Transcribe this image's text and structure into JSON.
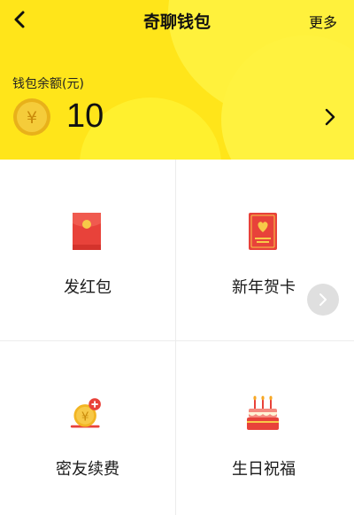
{
  "header": {
    "title": "奇聊钱包",
    "more_label": "更多"
  },
  "balance": {
    "label": "钱包余额(元)",
    "amount": "10",
    "coin_symbol": "¥"
  },
  "actions": [
    {
      "label": "发红包",
      "icon": "red-envelope-icon"
    },
    {
      "label": "新年贺卡",
      "icon": "new-year-card-icon"
    },
    {
      "label": "密友续费",
      "icon": "yen-coin-renew-icon"
    },
    {
      "label": "生日祝福",
      "icon": "birthday-cake-icon"
    }
  ],
  "colors": {
    "header_yellow": "#ffe51a",
    "coin_gold": "#f0c020",
    "red": "#e8423a"
  }
}
